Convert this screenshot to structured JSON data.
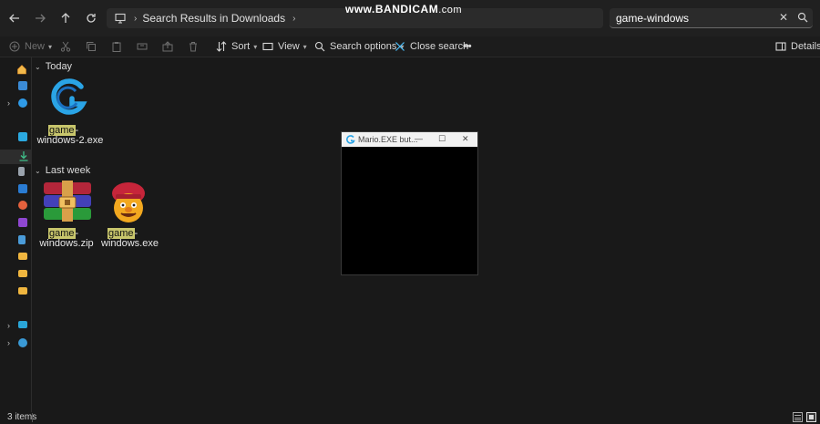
{
  "watermark": {
    "main": "www.BANDICAM",
    "tld": ".com"
  },
  "address": {
    "crumb": "Search Results in Downloads"
  },
  "search": {
    "value": "game-windows"
  },
  "commands": {
    "new_label": "New",
    "sort_label": "Sort",
    "view_label": "View",
    "search_options_label": "Search options",
    "close_search_label": "Close search",
    "more_label": "•••",
    "details_label": "Details"
  },
  "groups": [
    {
      "label": "Today"
    },
    {
      "label": "Last week"
    }
  ],
  "files": [
    {
      "highlight": "game",
      "rest": "-",
      "line2": "windows-2.exe",
      "icon": "gdevelop-icon"
    },
    {
      "highlight": "game",
      "rest": "-",
      "line2": "windows.zip",
      "icon": "winrar-archive-icon"
    },
    {
      "highlight": "game",
      "rest": "-",
      "line2": "windows.exe",
      "icon": "mario-character-icon"
    }
  ],
  "mario_window": {
    "title": "Mario.EXE but..."
  },
  "status": {
    "item_count": "3 items"
  },
  "colors": {
    "accent": "#4cc2ff",
    "highlight": "#c8c66c",
    "background": "#191919"
  }
}
